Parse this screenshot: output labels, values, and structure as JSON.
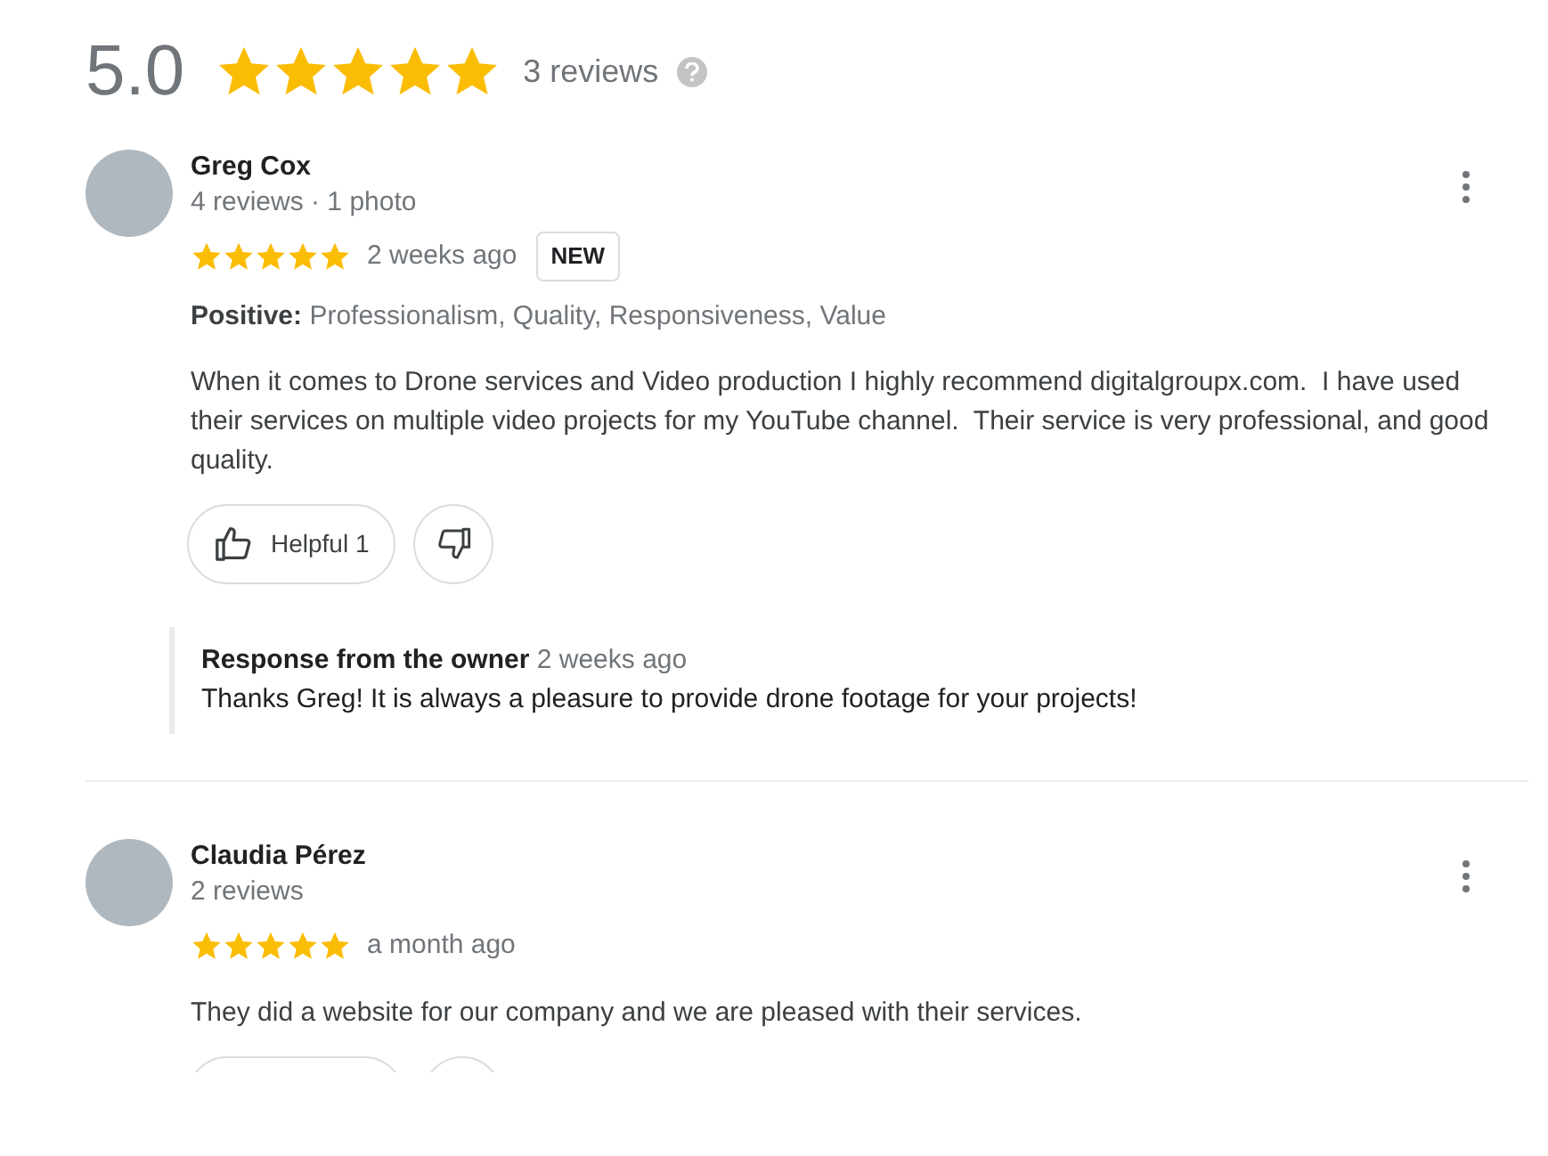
{
  "summary": {
    "rating": "5.0",
    "stars": 5,
    "count": "3 reviews"
  },
  "reviews": [
    {
      "name": "Greg Cox",
      "meta": "4 reviews · 1 photo",
      "stars": 5,
      "time": "2 weeks ago",
      "badge": "NEW",
      "positive_label": "Positive:",
      "positive": "Professionalism, Quality, Responsiveness, Value",
      "text": "When it comes to Drone services and Video production I highly recommend digitalgroupx.com.  I have used their services on multiple video projects for my YouTube channel.  Their service is very professional, and good quality.",
      "helpful": "Helpful 1",
      "response": {
        "title": "Response from the owner",
        "time": "2 weeks ago",
        "text": "Thanks Greg! It is always a pleasure to provide drone footage for your projects!"
      }
    },
    {
      "name": "Claudia Pérez",
      "meta": "2 reviews",
      "stars": 5,
      "time": "a month ago",
      "text": "They did a website for our company and we are pleased with their services."
    }
  ]
}
